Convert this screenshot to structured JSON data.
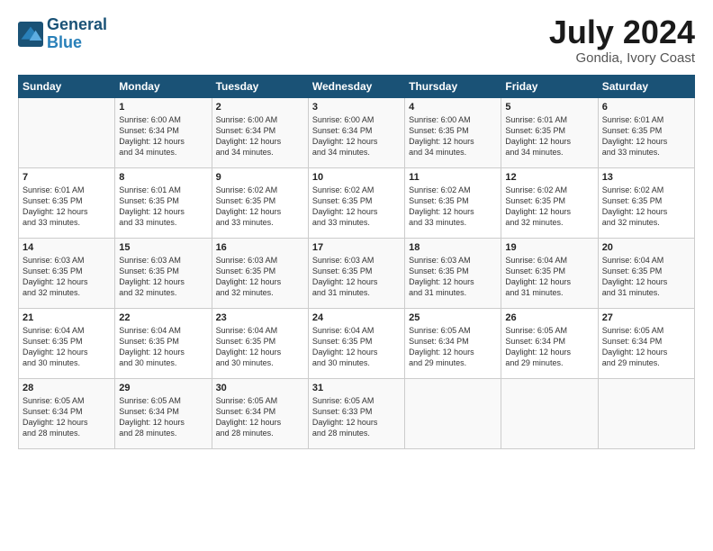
{
  "logo": {
    "line1": "General",
    "line2": "Blue"
  },
  "title": "July 2024",
  "subtitle": "Gondia, Ivory Coast",
  "weekdays": [
    "Sunday",
    "Monday",
    "Tuesday",
    "Wednesday",
    "Thursday",
    "Friday",
    "Saturday"
  ],
  "weeks": [
    [
      {
        "day": "",
        "info": ""
      },
      {
        "day": "1",
        "info": "Sunrise: 6:00 AM\nSunset: 6:34 PM\nDaylight: 12 hours\nand 34 minutes."
      },
      {
        "day": "2",
        "info": "Sunrise: 6:00 AM\nSunset: 6:34 PM\nDaylight: 12 hours\nand 34 minutes."
      },
      {
        "day": "3",
        "info": "Sunrise: 6:00 AM\nSunset: 6:34 PM\nDaylight: 12 hours\nand 34 minutes."
      },
      {
        "day": "4",
        "info": "Sunrise: 6:00 AM\nSunset: 6:35 PM\nDaylight: 12 hours\nand 34 minutes."
      },
      {
        "day": "5",
        "info": "Sunrise: 6:01 AM\nSunset: 6:35 PM\nDaylight: 12 hours\nand 34 minutes."
      },
      {
        "day": "6",
        "info": "Sunrise: 6:01 AM\nSunset: 6:35 PM\nDaylight: 12 hours\nand 33 minutes."
      }
    ],
    [
      {
        "day": "7",
        "info": "Sunrise: 6:01 AM\nSunset: 6:35 PM\nDaylight: 12 hours\nand 33 minutes."
      },
      {
        "day": "8",
        "info": "Sunrise: 6:01 AM\nSunset: 6:35 PM\nDaylight: 12 hours\nand 33 minutes."
      },
      {
        "day": "9",
        "info": "Sunrise: 6:02 AM\nSunset: 6:35 PM\nDaylight: 12 hours\nand 33 minutes."
      },
      {
        "day": "10",
        "info": "Sunrise: 6:02 AM\nSunset: 6:35 PM\nDaylight: 12 hours\nand 33 minutes."
      },
      {
        "day": "11",
        "info": "Sunrise: 6:02 AM\nSunset: 6:35 PM\nDaylight: 12 hours\nand 33 minutes."
      },
      {
        "day": "12",
        "info": "Sunrise: 6:02 AM\nSunset: 6:35 PM\nDaylight: 12 hours\nand 32 minutes."
      },
      {
        "day": "13",
        "info": "Sunrise: 6:02 AM\nSunset: 6:35 PM\nDaylight: 12 hours\nand 32 minutes."
      }
    ],
    [
      {
        "day": "14",
        "info": "Sunrise: 6:03 AM\nSunset: 6:35 PM\nDaylight: 12 hours\nand 32 minutes."
      },
      {
        "day": "15",
        "info": "Sunrise: 6:03 AM\nSunset: 6:35 PM\nDaylight: 12 hours\nand 32 minutes."
      },
      {
        "day": "16",
        "info": "Sunrise: 6:03 AM\nSunset: 6:35 PM\nDaylight: 12 hours\nand 32 minutes."
      },
      {
        "day": "17",
        "info": "Sunrise: 6:03 AM\nSunset: 6:35 PM\nDaylight: 12 hours\nand 31 minutes."
      },
      {
        "day": "18",
        "info": "Sunrise: 6:03 AM\nSunset: 6:35 PM\nDaylight: 12 hours\nand 31 minutes."
      },
      {
        "day": "19",
        "info": "Sunrise: 6:04 AM\nSunset: 6:35 PM\nDaylight: 12 hours\nand 31 minutes."
      },
      {
        "day": "20",
        "info": "Sunrise: 6:04 AM\nSunset: 6:35 PM\nDaylight: 12 hours\nand 31 minutes."
      }
    ],
    [
      {
        "day": "21",
        "info": "Sunrise: 6:04 AM\nSunset: 6:35 PM\nDaylight: 12 hours\nand 30 minutes."
      },
      {
        "day": "22",
        "info": "Sunrise: 6:04 AM\nSunset: 6:35 PM\nDaylight: 12 hours\nand 30 minutes."
      },
      {
        "day": "23",
        "info": "Sunrise: 6:04 AM\nSunset: 6:35 PM\nDaylight: 12 hours\nand 30 minutes."
      },
      {
        "day": "24",
        "info": "Sunrise: 6:04 AM\nSunset: 6:35 PM\nDaylight: 12 hours\nand 30 minutes."
      },
      {
        "day": "25",
        "info": "Sunrise: 6:05 AM\nSunset: 6:34 PM\nDaylight: 12 hours\nand 29 minutes."
      },
      {
        "day": "26",
        "info": "Sunrise: 6:05 AM\nSunset: 6:34 PM\nDaylight: 12 hours\nand 29 minutes."
      },
      {
        "day": "27",
        "info": "Sunrise: 6:05 AM\nSunset: 6:34 PM\nDaylight: 12 hours\nand 29 minutes."
      }
    ],
    [
      {
        "day": "28",
        "info": "Sunrise: 6:05 AM\nSunset: 6:34 PM\nDaylight: 12 hours\nand 28 minutes."
      },
      {
        "day": "29",
        "info": "Sunrise: 6:05 AM\nSunset: 6:34 PM\nDaylight: 12 hours\nand 28 minutes."
      },
      {
        "day": "30",
        "info": "Sunrise: 6:05 AM\nSunset: 6:34 PM\nDaylight: 12 hours\nand 28 minutes."
      },
      {
        "day": "31",
        "info": "Sunrise: 6:05 AM\nSunset: 6:33 PM\nDaylight: 12 hours\nand 28 minutes."
      },
      {
        "day": "",
        "info": ""
      },
      {
        "day": "",
        "info": ""
      },
      {
        "day": "",
        "info": ""
      }
    ]
  ]
}
